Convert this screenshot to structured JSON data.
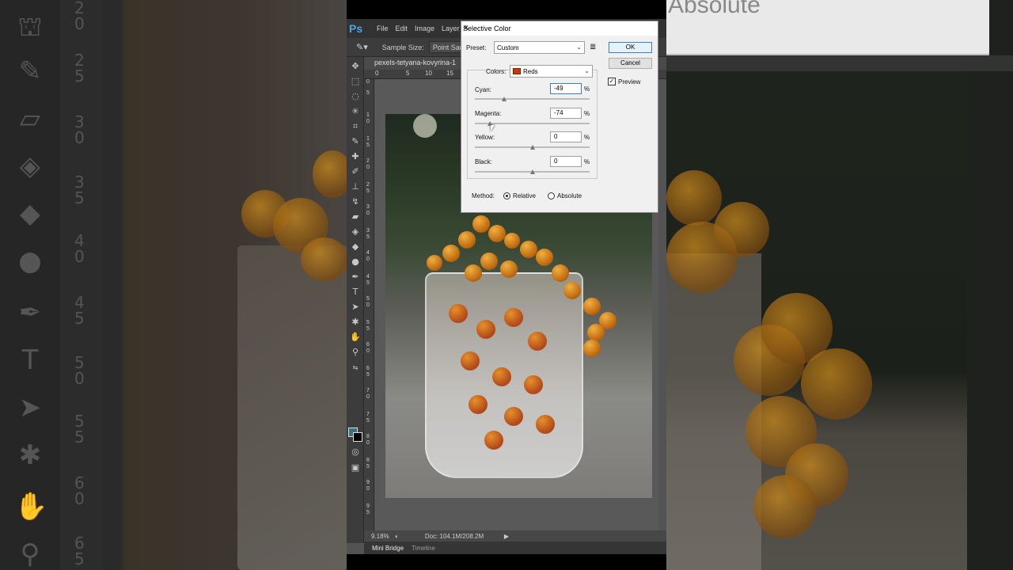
{
  "app": {
    "logo": "Ps",
    "menu": [
      "File",
      "Edit",
      "Image",
      "Layer"
    ],
    "options": {
      "sample_size_label": "Sample Size:",
      "sample_size_value": "Point Samp"
    },
    "document_tab": "pexels-tetyana-kovyrina-1",
    "ruler_h": [
      "0",
      "5",
      "10",
      "15"
    ],
    "ruler_v": [
      "0",
      "5",
      "1 0",
      "1 5",
      "2 0",
      "2 5",
      "3 0",
      "3 5",
      "4 0",
      "4 5",
      "5 0",
      "5 5",
      "6 0",
      "6 5",
      "7 0",
      "7 5",
      "8 0",
      "8 5",
      "9 0",
      "9 5"
    ],
    "status": {
      "zoom": "9.18%",
      "doc": "Doc: 104.1M/208.2M"
    },
    "panels": [
      "Mini Bridge",
      "Timeline"
    ]
  },
  "background": {
    "right_overlay_text": "Absolute",
    "left_ruler": [
      "2 0",
      "2 5",
      "3 0",
      "3 5",
      "4 0",
      "4 5",
      "5 0",
      "5 5",
      "6 0",
      "6 5"
    ]
  },
  "dialog": {
    "title": "Selective Color",
    "close": "✕",
    "preset_label": "Preset:",
    "preset_value": "Custom",
    "colors_label": "Colors:",
    "colors_value": "Reds",
    "colors_chip": "#c83a0a",
    "sliders": [
      {
        "label": "Cyan:",
        "value": "-49",
        "unit": "%",
        "level": -0.49
      },
      {
        "label": "Magenta:",
        "value": "-74",
        "unit": "%",
        "level": -0.74
      },
      {
        "label": "Yellow:",
        "value": "0",
        "unit": "%",
        "level": 0
      },
      {
        "label": "Black:",
        "value": "0",
        "unit": "%",
        "level": 0
      }
    ],
    "ok": "OK",
    "cancel": "Cancel",
    "preview_label": "Preview",
    "preview_checked": true,
    "method_label": "Method:",
    "method_relative": "Relative",
    "method_absolute": "Absolute",
    "method_selected": "Relative"
  }
}
